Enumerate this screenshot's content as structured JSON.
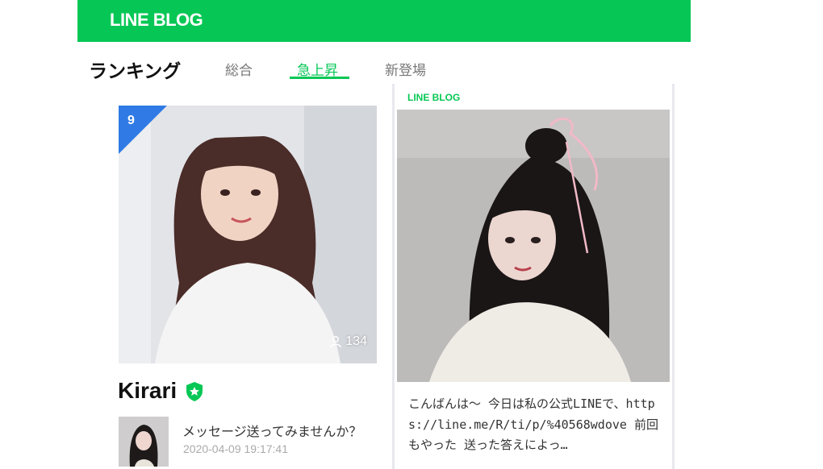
{
  "header": {
    "logo_text": "LINE BLOG",
    "brand_color": "#06c755"
  },
  "ranking": {
    "title": "ランキング",
    "tabs": [
      {
        "label": "総合",
        "active": false
      },
      {
        "label": "急上昇",
        "active": true
      },
      {
        "label": "新登場",
        "active": false
      }
    ]
  },
  "blog_card": {
    "rank": "9",
    "followers": "134",
    "name": "Kirari",
    "official_icon": "official-star-shield-icon",
    "latest_post": {
      "title": "メッセージ送ってみませんか？",
      "date": "2020-04-09 19:17:41"
    }
  },
  "preview": {
    "logo_text": "LINE BLOG",
    "excerpt": "こんばんは〜 今日は私の公式LINEで、https://line.me/R/ti/p/%40568wdove 前回もやった 送った答えによっ…"
  },
  "colors": {
    "accent": "#06c755",
    "rank_badge": "#2f7ae5"
  }
}
